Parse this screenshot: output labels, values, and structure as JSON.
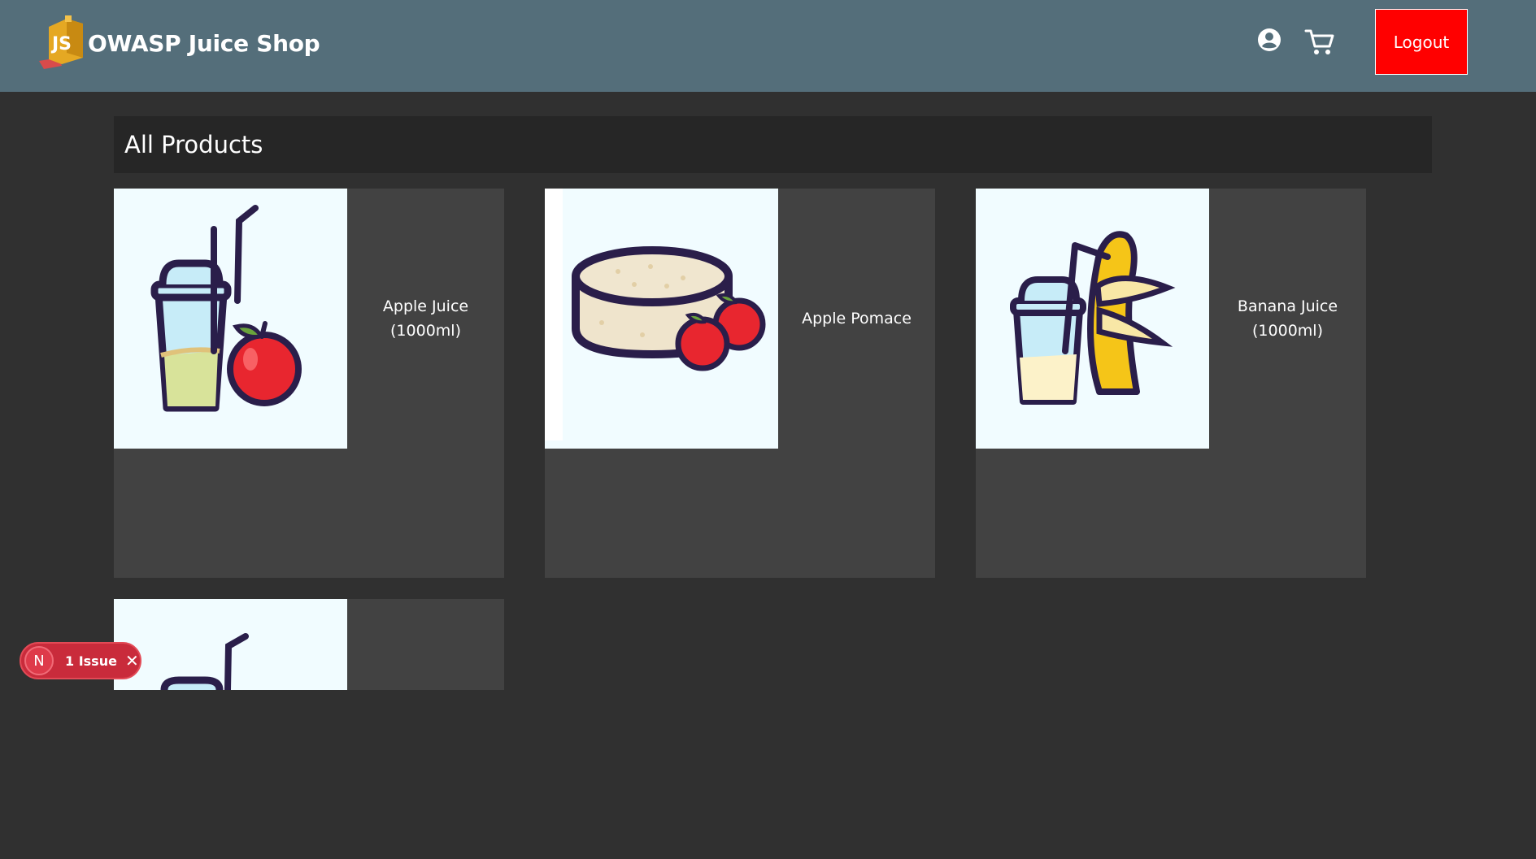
{
  "header": {
    "title": "OWASP Juice Shop",
    "logo_icon": "juice-carton-logo",
    "account_icon": "account-circle-icon",
    "cart_icon": "shopping-cart-icon",
    "logout_label": "Logout",
    "background_color": "#546e7a",
    "logout_color": "#ff0000"
  },
  "main": {
    "heading": "All Products",
    "products": [
      {
        "name": "Apple Juice (1000ml)",
        "image_icon": "apple-juice-cup-icon"
      },
      {
        "name": "Apple Pomace",
        "image_icon": "apple-pomace-icon"
      },
      {
        "name": "Banana Juice (1000ml)",
        "image_icon": "banana-juice-cup-icon"
      },
      {
        "name": "",
        "image_icon": "juice-cup-icon"
      }
    ]
  },
  "devtools": {
    "logo_letter": "N",
    "issues_label": "1 Issue",
    "close_glyph": "✕"
  }
}
